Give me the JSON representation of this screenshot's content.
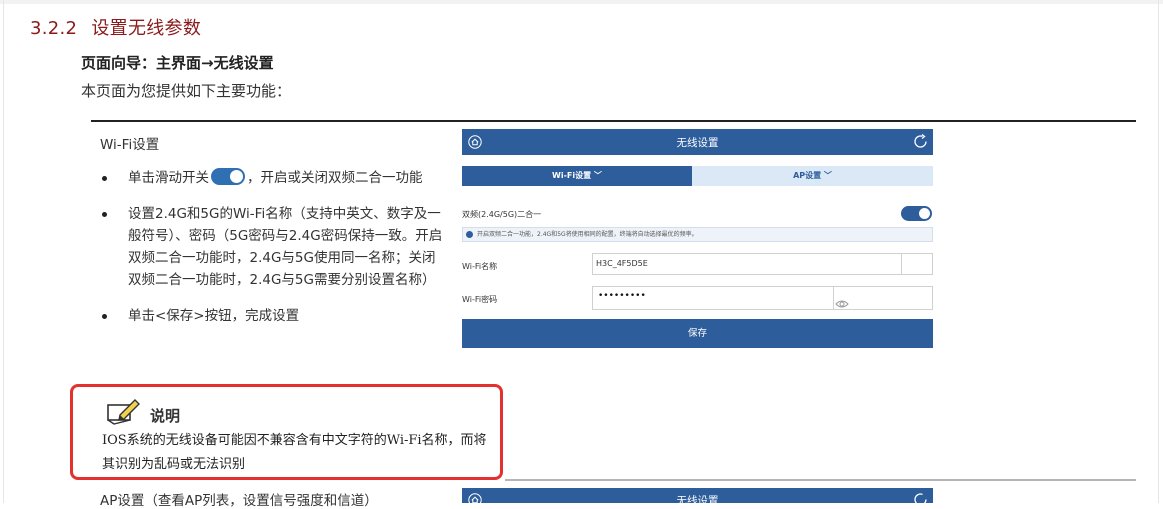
{
  "section": {
    "number": "3.2.2",
    "title": "设置无线参数"
  },
  "guide": "页面向导：主界面→无线设置",
  "intro": "本页面为您提供如下主要功能：",
  "wifi": {
    "heading": "Wi-Fi设置",
    "bullet1_before": "单击滑动开关",
    "bullet1_after": "，开启或关闭双频二合一功能",
    "bullet2": "设置2.4G和5G的Wi-Fi名称（支持中英文、数字及一般符号）、密码（5G密码与2.4G密码保持一致。开启双频二合一功能时，2.4G与5G使用同一名称；关闭双频二合一功能时，2.4G与5G需要分别设置名称）",
    "bullet3": "单击<保存>按钮，完成设置"
  },
  "note": {
    "title": "说明",
    "text": "IOS系统的无线设备可能因不兼容含有中文字符的Wi-Fi名称，而将其识别为乱码或无法识别"
  },
  "ap": {
    "heading": "AP设置（查看AP列表，设置信号强度和信道）"
  },
  "screenshot": {
    "header_title": "无线设置",
    "tab_wifi": "Wi-Fi设置 ﹀",
    "tab_ap": "AP设置 ﹀",
    "dual_band_label": "双频(2.4G/5G)二合一",
    "dual_band_on": true,
    "info_text": "开启双频二合一功能，2.4G和5G将使用相同的配置，终端将自动选择最优的频率。",
    "wifi_name_label": "Wi-Fi名称",
    "wifi_name_value": "H3C_4F5D5E",
    "wifi_pwd_label": "Wi-Fi密码",
    "wifi_pwd_value": "•••••••••",
    "save_label": "保存",
    "icons": [
      "home-icon",
      "refresh-icon",
      "eye-icon",
      "info-icon"
    ],
    "accent": "#2d5d9b"
  },
  "screenshot2": {
    "header_title": "无线设置"
  },
  "colors": {
    "section_title": "#8b1a1a",
    "note_border": "#e53030",
    "toggle": "#2f6fb3"
  }
}
